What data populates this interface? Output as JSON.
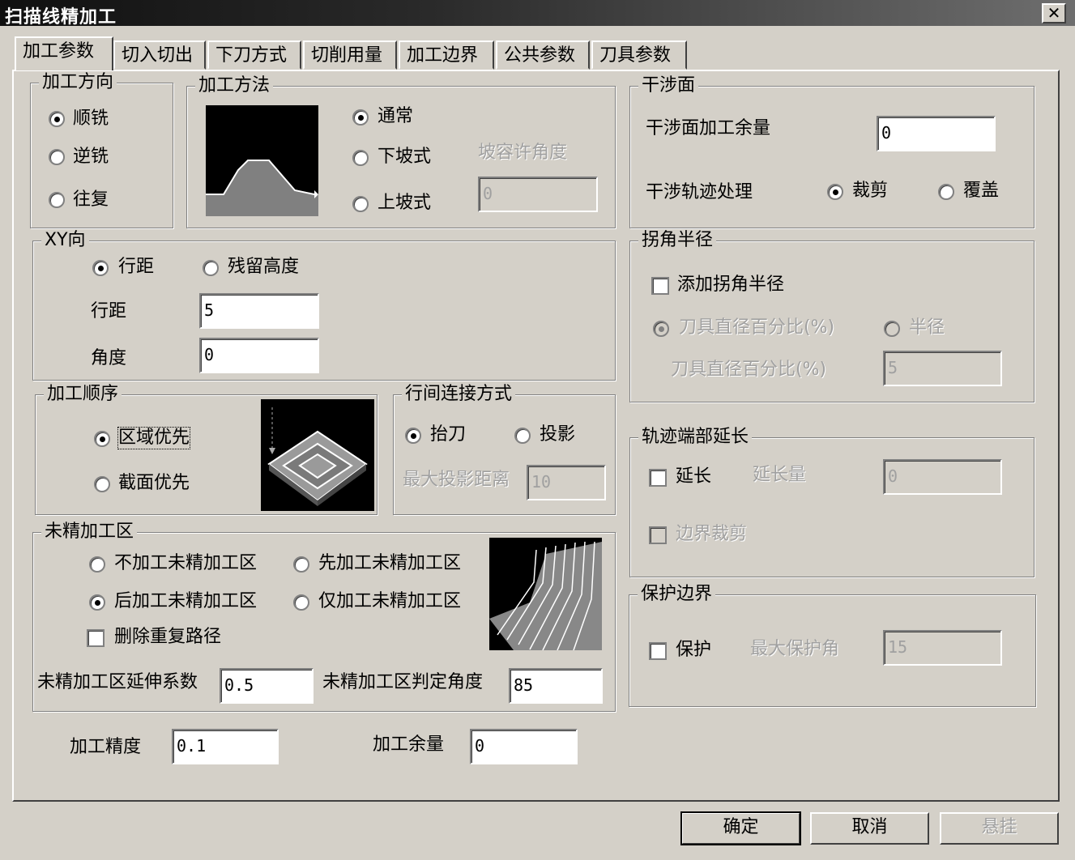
{
  "title": "扫描线精加工",
  "close_symbol": "✕",
  "tabs": [
    "加工参数",
    "切入切出",
    "下刀方式",
    "切削用量",
    "加工边界",
    "公共参数",
    "刀具参数"
  ],
  "direction": {
    "legend": "加工方向",
    "options": [
      "顺铣",
      "逆铣",
      "往复"
    ]
  },
  "method": {
    "legend": "加工方法",
    "options": [
      "通常",
      "下坡式",
      "上坡式"
    ],
    "slope_label": "坡容许角度",
    "slope_value": "0"
  },
  "interference": {
    "legend": "干涉面",
    "allowance_label": "干涉面加工余量",
    "allowance_value": "0",
    "path_label": "干涉轨迹处理",
    "opt_cut": "裁剪",
    "opt_cover": "覆盖"
  },
  "xy": {
    "legend": "XY向",
    "opt_stepover": "行距",
    "opt_residual": "残留高度",
    "stepover_label": "行距",
    "stepover_value": "5",
    "angle_label": "角度",
    "angle_value": "0"
  },
  "corner": {
    "legend": "拐角半径",
    "add_label": "添加拐角半径",
    "opt_percent": "刀具直径百分比(%)",
    "opt_radius": "半径",
    "percent_label": "刀具直径百分比(%)",
    "percent_value": "5"
  },
  "order": {
    "legend": "加工顺序",
    "opt_region": "区域优先",
    "opt_section": "截面优先"
  },
  "link": {
    "legend": "行间连接方式",
    "opt_lift": "抬刀",
    "opt_projection": "投影",
    "max_label": "最大投影距离",
    "max_value": "10"
  },
  "extend": {
    "legend": "轨迹端部延长",
    "extend_label": "延长",
    "amount_label": "延长量",
    "amount_value": "0",
    "trim_label": "边界裁剪"
  },
  "unfinished": {
    "legend": "未精加工区",
    "opt1": "不加工未精加工区",
    "opt2": "先加工未精加工区",
    "opt3": "后加工未精加工区",
    "opt4": "仅加工未精加工区",
    "delete_label": "删除重复路径",
    "ext_label": "未精加工区延伸系数",
    "ext_value": "0.5",
    "angle_label": "未精加工区判定角度",
    "angle_value": "85"
  },
  "protect": {
    "legend": "保护边界",
    "protect_label": "保护",
    "max_label": "最大保护角",
    "max_value": "15"
  },
  "bottom": {
    "precision_label": "加工精度",
    "precision_value": "0.1",
    "allowance_label": "加工余量",
    "allowance_value": "0"
  },
  "buttons": {
    "ok": "确定",
    "cancel": "取消",
    "suspend": "悬挂"
  }
}
